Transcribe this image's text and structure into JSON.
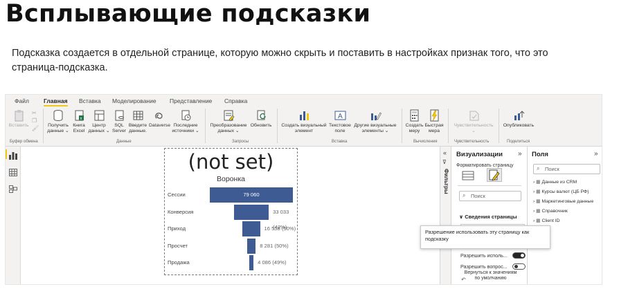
{
  "slide": {
    "title": "Всплывающие подсказки",
    "description": "Подсказка создается в отдельной странице, которую можно скрыть и поставить в настройках признак того, что это страница-подсказка."
  },
  "ribbon": {
    "tabs": [
      "Файл",
      "Главная",
      "Вставка",
      "Моделирование",
      "Представление",
      "Справка"
    ],
    "active_tab": "Главная",
    "buttons": {
      "paste": "Вставить",
      "get_data_1": "Получить",
      "get_data_2": "данные ⌄",
      "excel_1": "Книга",
      "excel_2": "Excel",
      "hub_1": "Центр",
      "hub_2": "данных ⌄",
      "sql_1": "SQL",
      "sql_2": "Server",
      "enter_1": "Введите",
      "enter_2": "данные.",
      "dataverse": "Dataverse",
      "recent_1": "Последние",
      "recent_2": "источники ⌄",
      "transform_1": "Преобразование",
      "transform_2": "данных ⌄",
      "refresh": "Обновить",
      "newvis_1": "Создать визуальный",
      "newvis_2": "элемент",
      "textbox_1": "Текстовое",
      "textbox_2": "поле",
      "morevis_1": "Другие визуальные",
      "morevis_2": "элементы ⌄",
      "newmeasure_1": "Создать",
      "newmeasure_2": "меру",
      "quickmeasure_1": "Быстрая",
      "quickmeasure_2": "мера",
      "sensitivity_1": "Чувствительность",
      "sensitivity_2": "⌄",
      "publish": "Опубликовать"
    },
    "groups": {
      "clipboard": "Буфер обмена",
      "data": "Данные",
      "queries": "Запросы",
      "insert": "Вставка",
      "calculations": "Вычисления",
      "sensitivity": "Чувствительность",
      "share": "Поделиться"
    }
  },
  "canvas": {
    "card_value": "(not set)",
    "funnel": {
      "title": "Воронка",
      "stages": [
        {
          "label": "Сессии",
          "value": "79 060",
          "fraction": 1.0
        },
        {
          "label": "Конверсия",
          "value": "33 033 (42%)",
          "fraction": 0.418
        },
        {
          "label": "Приход",
          "value": "16 558 (50%)",
          "fraction": 0.209
        },
        {
          "label": "Просчет",
          "value": "8 281 (50%)",
          "fraction": 0.105
        },
        {
          "label": "Продажа",
          "value": "4 086 (49%)",
          "fraction": 0.052
        }
      ]
    }
  },
  "filters": {
    "label": "Фильтры"
  },
  "visualizations": {
    "title": "Визуализации",
    "subtitle": "Форматировать страницу",
    "search_placeholder": "Поиск",
    "section": "Сведения страницы",
    "toggle_1": "Разрешить исполь...",
    "toggle_2": "Разрешить вопрос...",
    "toggle_1_on": true,
    "toggle_2_on": false,
    "back_label_1": "Вернуться к значениям",
    "back_label_2": "по умолчанию"
  },
  "fields": {
    "title": "Поля",
    "search_placeholder": "Поиск",
    "items": [
      "Данные из CRM",
      "Курсы валют (ЦБ РФ)",
      "Маркетинговые данные",
      "Справочник",
      "Client ID"
    ]
  },
  "tooltip": {
    "text": "Разрешение использовать эту страницу как подсказку"
  },
  "colors": {
    "funnel_bar": "#3f5b94",
    "accent": "#f2c811",
    "toggle_on": "#252423"
  }
}
